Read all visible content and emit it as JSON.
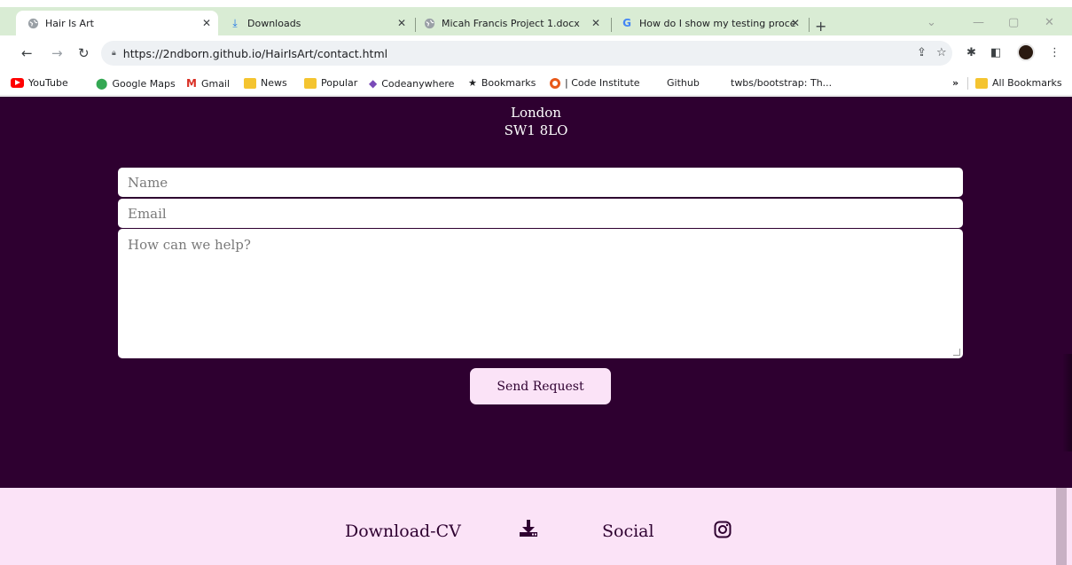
{
  "tabs": [
    {
      "title": "Hair Is Art",
      "icon": "globe-icon",
      "active": true
    },
    {
      "title": "Downloads",
      "icon": "download-icon",
      "active": false
    },
    {
      "title": "Micah Francis Project 1.docx",
      "icon": "globe-icon",
      "active": false
    },
    {
      "title": "How do I show my testing proce",
      "icon": "google-icon",
      "active": false
    }
  ],
  "omnibar": {
    "url": "https://2ndborn.github.io/HairIsArt/contact.html"
  },
  "bookmarks": [
    {
      "label": "YouTube",
      "icon": "youtube-icon"
    },
    {
      "label": "Google Maps",
      "icon": "maps-icon"
    },
    {
      "label": "Gmail",
      "icon": "gmail-icon"
    },
    {
      "label": "News",
      "icon": "folder-icon"
    },
    {
      "label": "Popular",
      "icon": "folder-icon"
    },
    {
      "label": "Codeanywhere",
      "icon": "cube-icon"
    },
    {
      "label": "Bookmarks",
      "icon": "star-icon"
    },
    {
      "label": "| Code Institute",
      "icon": "code-institute-icon"
    },
    {
      "label": "Github",
      "icon": ""
    },
    {
      "label": "twbs/bootstrap: Th...",
      "icon": ""
    }
  ],
  "bookmarks_overflow": "»",
  "all_bookmarks": "All Bookmarks",
  "page": {
    "address_line_city": "London",
    "address_line_postcode": "SW1 8LO",
    "form": {
      "name_placeholder": "Name",
      "email_placeholder": "Email",
      "message_placeholder": "How can we help?",
      "send_label": "Send Request"
    },
    "footer": {
      "download_label": "Download-CV",
      "social_label": "Social"
    }
  },
  "colors": {
    "page_background": "#2e0030",
    "button_background": "#fbe3f7",
    "footer_background": "#fbe3f7",
    "tabbar_background": "#d9ecd4"
  }
}
